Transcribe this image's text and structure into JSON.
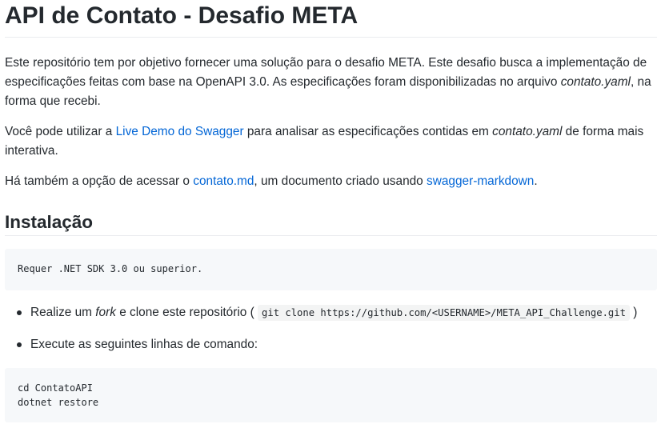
{
  "title": "API de Contato - Desafio META",
  "intro": {
    "line1": "Este repositório tem por objetivo fornecer uma solução para o desafio META. Este desafio busca a implementação de",
    "line2_a": "especificações feitas com base na OpenAPI 3.0. As especificações foram disponibilizadas no arquivo ",
    "line2_em": "contato.yaml",
    "line2_b": ", na",
    "line3": "forma que recebi."
  },
  "swagger_para": {
    "text_a": "Você pode utilizar a ",
    "link": "Live Demo do Swagger",
    "text_b": " para analisar as especificações contidas em ",
    "em": "contato.yaml",
    "text_c": " de forma mais",
    "line2": "interativa."
  },
  "doc_para": {
    "text_a": "Há também a opção de acessar o ",
    "link1": "contato.md",
    "text_b": ", um documento criado usando ",
    "link2": "swagger-markdown",
    "text_c": "."
  },
  "install": {
    "heading": "Instalação",
    "requirement_code": "Requer .NET SDK 3.0 ou superior.",
    "step1": {
      "text_a": "Realize um ",
      "em": "fork",
      "text_b": " e clone este repositório ( ",
      "code": "git clone https://github.com/<USERNAME>/META_API_Challenge.git",
      "text_c": " )"
    },
    "step2": "Execute as seguintes linhas de comando:",
    "commands": "cd ContatoAPI\ndotnet restore"
  }
}
